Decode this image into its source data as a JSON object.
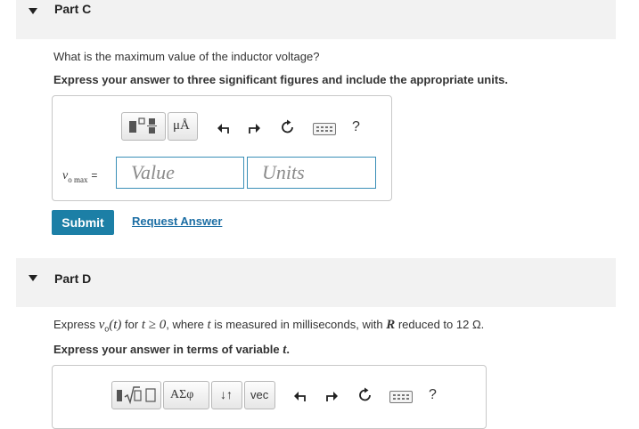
{
  "part_c": {
    "title": "Part C",
    "question": "What is the maximum value of the inductor voltage?",
    "instruction": "Express your answer to three significant figures and include the appropriate units.",
    "answer_label_var": "v",
    "answer_label_sub": "o max",
    "answer_label_eq": "=",
    "value_placeholder": "Value",
    "units_placeholder": "Units",
    "units_button": "μÅ",
    "help_button": "?",
    "submit_label": "Submit",
    "request_answer_label": "Request Answer"
  },
  "part_d": {
    "title": "Part D",
    "question_pre": "Express ",
    "question_vo_var": "v",
    "question_vo_sub": "o",
    "question_vo_arg": "(t)",
    "question_for": " for ",
    "question_ineq": "t ≥ 0",
    "question_where": ", where ",
    "question_t": "t",
    "question_mid": " is measured in milliseconds, with ",
    "question_R": "R",
    "question_end": " reduced to 12 Ω.",
    "instruction_pre": "Express your answer in terms of variable ",
    "instruction_var": "t",
    "instruction_post": ".",
    "greek_button": "ΑΣφ",
    "sort_button": "↓↑",
    "vec_button": "vec",
    "help_button": "?"
  },
  "icons": {
    "undo": "undo-arrow-icon",
    "redo": "redo-arrow-icon",
    "reset": "reset-icon",
    "keyboard": "keyboard-icon",
    "templates": "templates-icon",
    "sqrt_templates": "sqrt-templates-icon",
    "collapse": "collapse-triangle-icon"
  },
  "colors": {
    "accent": "#1c7fa6",
    "link": "#1c6ea4",
    "field_border": "#3a8fb7"
  }
}
